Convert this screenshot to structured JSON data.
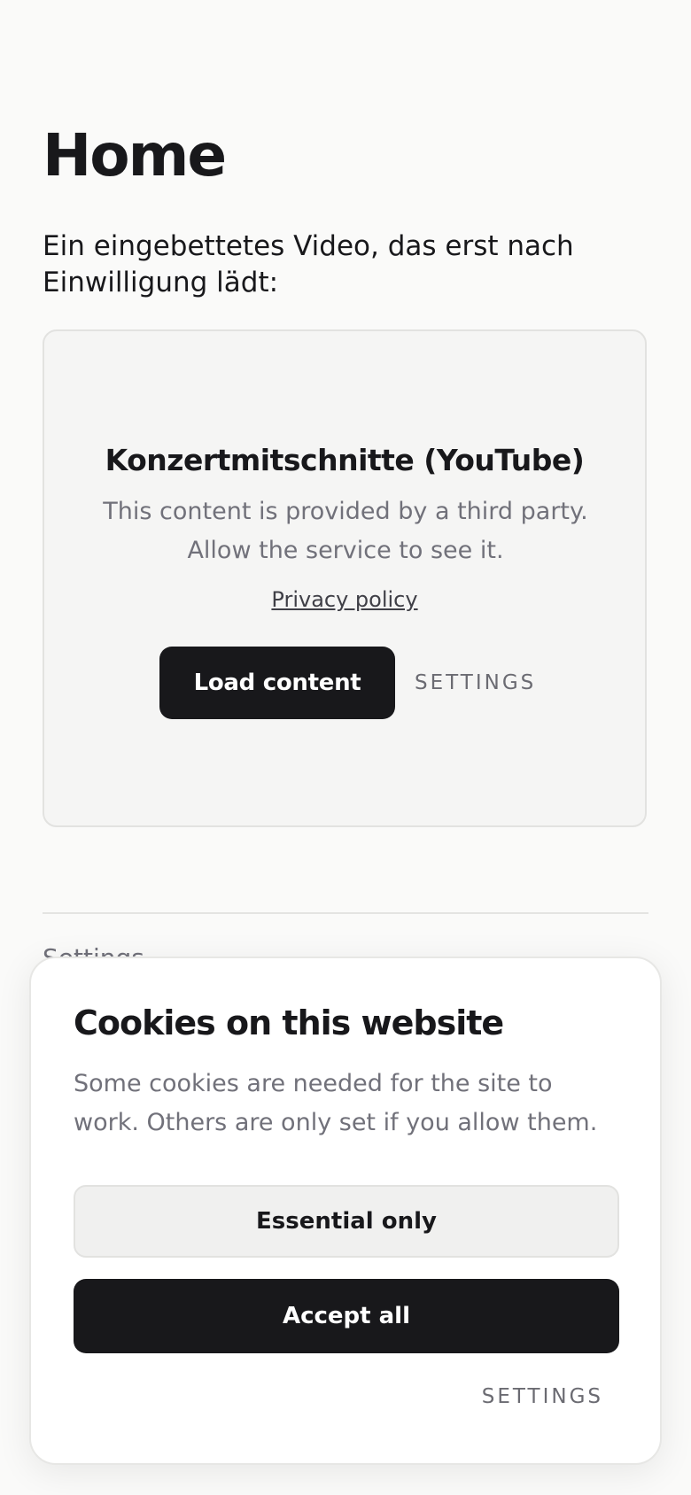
{
  "page": {
    "title": "Home",
    "intro": "Ein eingebettetes Video, das erst nach Einwilligung lädt:"
  },
  "embed": {
    "title": "Konzertmitschnitte (YouTube)",
    "description": "This content is provided by a third party. Allow the service to see it.",
    "privacy_link": "Privacy policy",
    "load_button": "Load content",
    "settings_link": "SETTINGS"
  },
  "section": {
    "label": "Settings"
  },
  "cookie_banner": {
    "title": "Cookies on this website",
    "description": "Some cookies are needed for the site to work. Others are only set if you allow them.",
    "essential_button": "Essential only",
    "accept_button": "Accept all",
    "settings_link": "SETTINGS"
  },
  "colors": {
    "background": "#fafaf9",
    "primary_button": "#18181b",
    "muted_text": "#71717a"
  }
}
